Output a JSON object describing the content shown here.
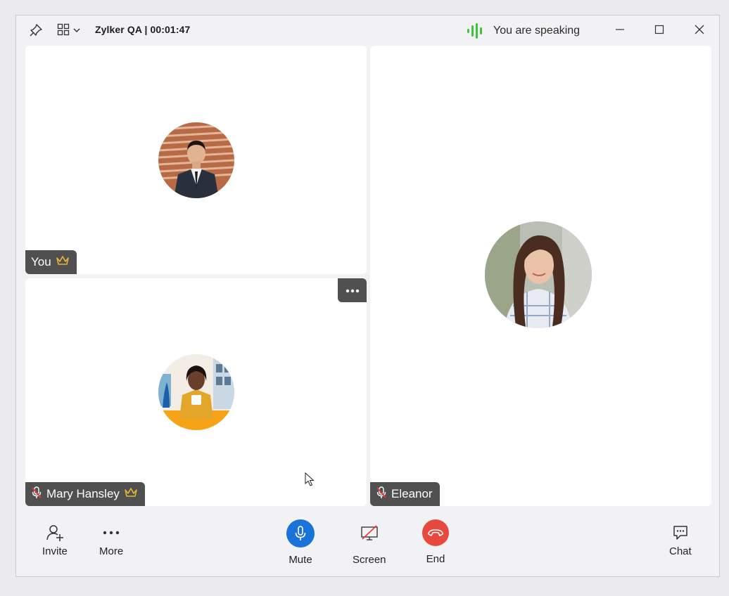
{
  "window": {
    "title": "Zylker QA | 00:01:47",
    "speaking_status": "You are speaking",
    "icons": [
      "pin-icon",
      "grid-layout-icon",
      "chevron-down-icon",
      "minimize-icon",
      "maximize-icon",
      "close-icon"
    ]
  },
  "participants": [
    {
      "name": "You",
      "host": true,
      "muted": false
    },
    {
      "name": "Mary Hansley",
      "host": true,
      "muted": true
    },
    {
      "name": "Eleanor",
      "host": false,
      "muted": true
    }
  ],
  "toolbar": {
    "invite_label": "Invite",
    "more_label": "More",
    "mute_label": "Mute",
    "screen_label": "Screen",
    "end_label": "End",
    "chat_label": "Chat"
  },
  "colors": {
    "mute_button": "#1a73d9",
    "end_button": "#e8493f",
    "speaking_indicator": "#3cc43c",
    "host_crown": "#e8b33a",
    "muted_mic": "#e53935",
    "nametag_bg": "#505050"
  }
}
